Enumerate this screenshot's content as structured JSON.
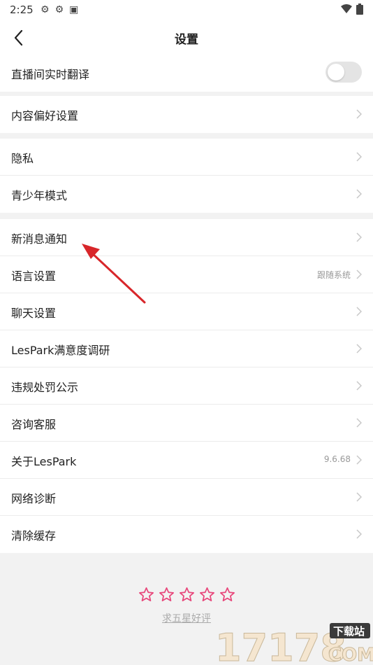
{
  "status_bar": {
    "time": "2:25"
  },
  "header": {
    "title": "设置"
  },
  "groups": [
    {
      "items": [
        {
          "label": "直播间实时翻译",
          "toggle": "off"
        }
      ]
    },
    {
      "items": [
        {
          "label": "内容偏好设置"
        }
      ]
    },
    {
      "items": [
        {
          "label": "隐私"
        },
        {
          "label": "青少年模式"
        }
      ]
    },
    {
      "items": [
        {
          "label": "新消息通知"
        },
        {
          "label": "语言设置",
          "value": "跟随系统"
        },
        {
          "label": "聊天设置"
        },
        {
          "label": "LesPark满意度调研"
        },
        {
          "label": "违规处罚公示"
        },
        {
          "label": "咨询客服"
        },
        {
          "label": "关于LesPark",
          "value": "9.6.68"
        },
        {
          "label": "网络诊断"
        },
        {
          "label": "清除缓存"
        }
      ]
    }
  ],
  "rating": {
    "stars": 5,
    "text": "求五星好评"
  },
  "watermark": {
    "text": "17178",
    "sub": "下载站",
    "domain": "COM"
  },
  "colors": {
    "star": "#e8467a",
    "toggle_off": "#e4e4e4",
    "arrow": "#d8262a"
  }
}
